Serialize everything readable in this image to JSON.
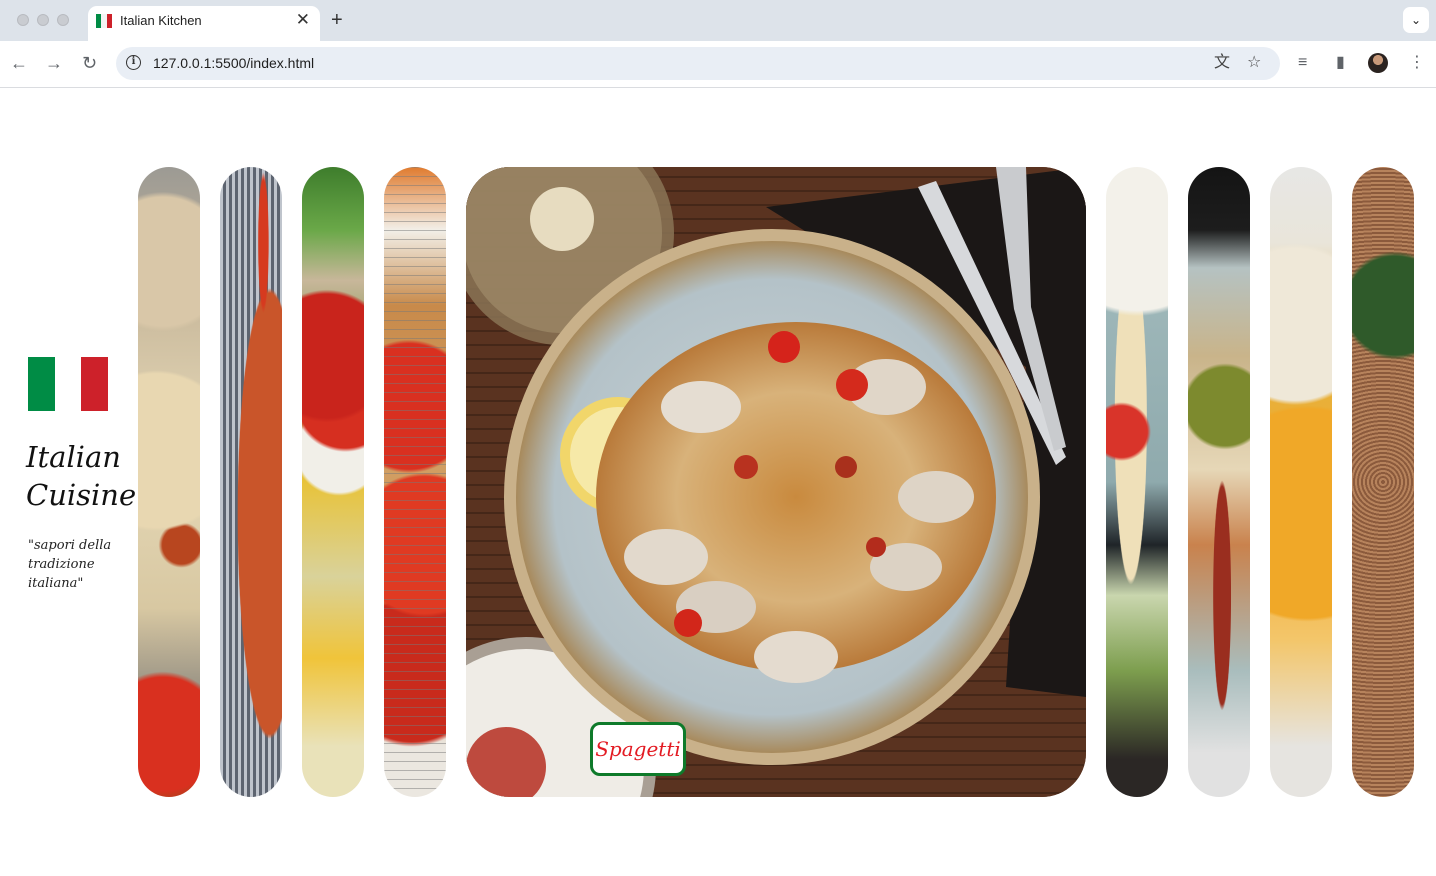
{
  "browser": {
    "tab_title": "Italian Kitchen",
    "tab_close": "✕",
    "new_tab": "+",
    "tab_menu": "⌄",
    "url": "127.0.0.1:5500/index.html",
    "back_icon": "←",
    "forward_icon": "→",
    "reload_icon": "↻",
    "translate_icon": "文",
    "bookmark_icon": "☆",
    "media_icon": "≡",
    "sidepanel_icon": "▮",
    "menu_icon": "⋮"
  },
  "sidebar": {
    "flag_colors": [
      "#008c45",
      "#ffffff",
      "#cd212a"
    ],
    "brand_line1": "Italian",
    "brand_line2": "Cuisine",
    "tagline": "\"sapori della tradizione italiana\""
  },
  "gallery": {
    "active_label": "Spagetti",
    "images": [
      {
        "name": "pizza-image"
      },
      {
        "name": "spaghetti-bowl-image"
      },
      {
        "name": "tomatoes-pasta-image"
      },
      {
        "name": "bruschetta-image"
      },
      {
        "name": "spaghetti-clams-image",
        "active": true
      },
      {
        "name": "tagliatelle-image"
      },
      {
        "name": "dark-plate-image"
      },
      {
        "name": "lasagna-image"
      },
      {
        "name": "tiramisu-image"
      }
    ]
  }
}
